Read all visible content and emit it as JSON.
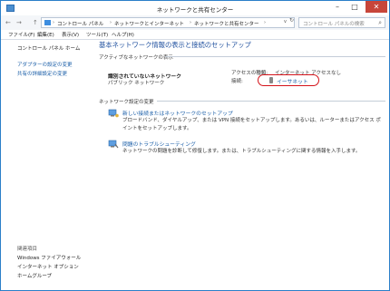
{
  "window": {
    "title": "ネットワークと共有センター",
    "controls": {
      "minimize": "–",
      "maximize": "□",
      "close": "✕"
    }
  },
  "address": {
    "back": "←",
    "forward": "→",
    "up": "↑",
    "crumbs": [
      "コントロール パネル",
      "ネットワークとインターネット",
      "ネットワークと共有センター"
    ],
    "separator": "›",
    "dropdown": "v",
    "refresh": "↻",
    "search_placeholder": "コントロール パネルの検索",
    "search_icon": "⌕"
  },
  "menu": [
    "ファイル(F)",
    "編集(E)",
    "表示(V)",
    "ツール(T)",
    "ヘルプ(H)"
  ],
  "left": {
    "home": "コントロール パネル ホーム",
    "links": [
      "アダプターの設定の変更",
      "共有の詳細設定の変更"
    ],
    "see_also": "関連項目",
    "related": [
      "Windows ファイアウォール",
      "インターネット オプション",
      "ホームグループ"
    ]
  },
  "main": {
    "title": "基本ネットワーク情報の表示と接続のセットアップ",
    "active_section": "アクティブなネットワークの表示",
    "network": {
      "name": "識別されていないネットワーク",
      "type": "パブリック ネットワーク",
      "access_label": "アクセスの種類:",
      "access_value": "インターネット アクセスなし",
      "connection_label": "接続:",
      "connection_value": "イーサネット"
    },
    "change_section": "ネットワーク設定の変更",
    "tasks": [
      {
        "icon": "new-connection-icon",
        "link": "新しい接続またはネットワークのセットアップ",
        "desc": "ブロードバンド、ダイヤルアップ、または VPN 接続をセットアップします。あるいは、ルーターまたはアクセス ポイントをセットアップします。"
      },
      {
        "icon": "troubleshoot-icon",
        "link": "問題のトラブルシューティング",
        "desc": "ネットワークの問題を診断して修復します。または、トラブルシューティングに関する情報を入手します。"
      }
    ]
  },
  "colors": {
    "title_blue": "#1e4f9e",
    "link_blue": "#1a5ea8",
    "highlight_red": "#d4131a",
    "close_red": "#c7463a"
  }
}
